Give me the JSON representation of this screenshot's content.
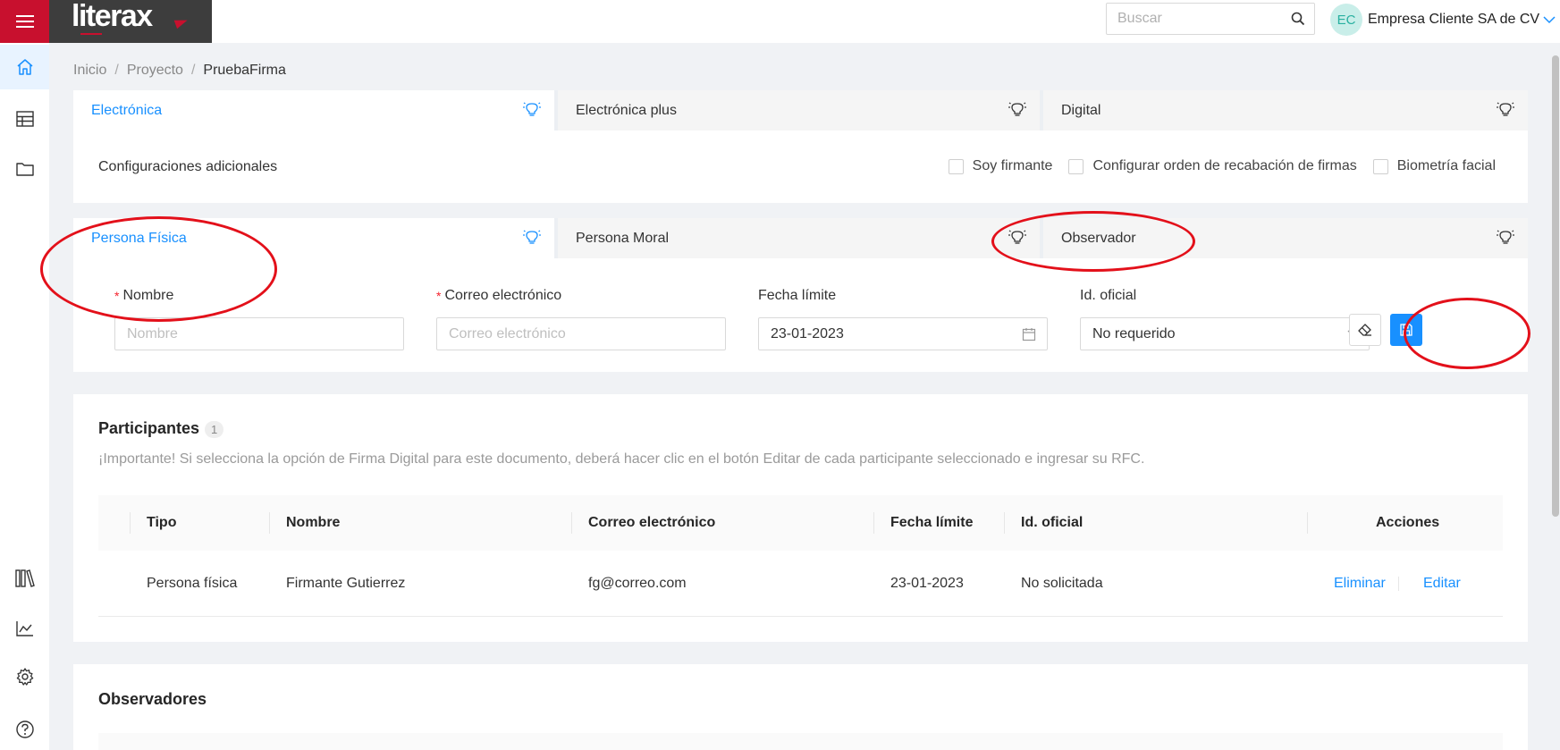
{
  "app": {
    "logo_text": "literax",
    "colors": {
      "brand_red": "#c8102e",
      "accent_blue": "#1890ff",
      "annotation_red": "#e3101a"
    }
  },
  "header": {
    "search": {
      "placeholder": "Buscar"
    },
    "user": {
      "initials": "EC",
      "name": "Empresa Cliente SA de CV"
    }
  },
  "sidebar": {
    "items": [
      {
        "icon": "home-icon",
        "active": true
      },
      {
        "icon": "table-icon",
        "active": false
      },
      {
        "icon": "folder-icon",
        "active": false
      },
      {
        "icon": "library-icon",
        "active": false
      },
      {
        "icon": "chart-icon",
        "active": false
      },
      {
        "icon": "gear-icon",
        "active": false
      },
      {
        "icon": "help-icon",
        "active": false
      }
    ]
  },
  "breadcrumb": {
    "items": [
      "Inicio",
      "Proyecto",
      "PruebaFirma"
    ]
  },
  "signature_type": {
    "tabs": [
      {
        "label": "Electrónica",
        "active": true
      },
      {
        "label": "Electrónica plus",
        "active": false
      },
      {
        "label": "Digital",
        "active": false
      }
    ],
    "extras_label": "Configuraciones adicionales",
    "options": [
      {
        "label": "Soy firmante",
        "checked": false
      },
      {
        "label": "Configurar orden de recabación de firmas",
        "checked": false
      },
      {
        "label": "Biometría facial",
        "checked": false
      }
    ]
  },
  "person_type": {
    "tabs": [
      {
        "label": "Persona Física",
        "active": true
      },
      {
        "label": "Persona Moral",
        "active": false
      },
      {
        "label": "Observador",
        "active": false
      }
    ],
    "form": {
      "nombre": {
        "label": "Nombre",
        "placeholder": "Nombre",
        "required": true,
        "value": ""
      },
      "correo": {
        "label": "Correo electrónico",
        "placeholder": "Correo electrónico",
        "required": true,
        "value": ""
      },
      "fecha": {
        "label": "Fecha límite",
        "value": "23-01-2023"
      },
      "id_oficial": {
        "label": "Id. oficial",
        "value": "No requerido"
      }
    }
  },
  "participants": {
    "title": "Participantes",
    "count": "1",
    "notice": "¡Importante! Si selecciona la opción de Firma Digital para este documento, deberá hacer clic en el botón Editar de cada participante seleccionado e ingresar su RFC.",
    "columns": [
      "Tipo",
      "Nombre",
      "Correo electrónico",
      "Fecha límite",
      "Id. oficial",
      "Acciones"
    ],
    "rows": [
      {
        "tipo": "Persona física",
        "nombre": "Firmante Gutierrez",
        "correo": "fg@correo.com",
        "fecha": "23-01-2023",
        "id_oficial": "No solicitada",
        "actions": {
          "delete": "Eliminar",
          "edit": "Editar"
        }
      }
    ]
  },
  "observers": {
    "title": "Observadores"
  }
}
